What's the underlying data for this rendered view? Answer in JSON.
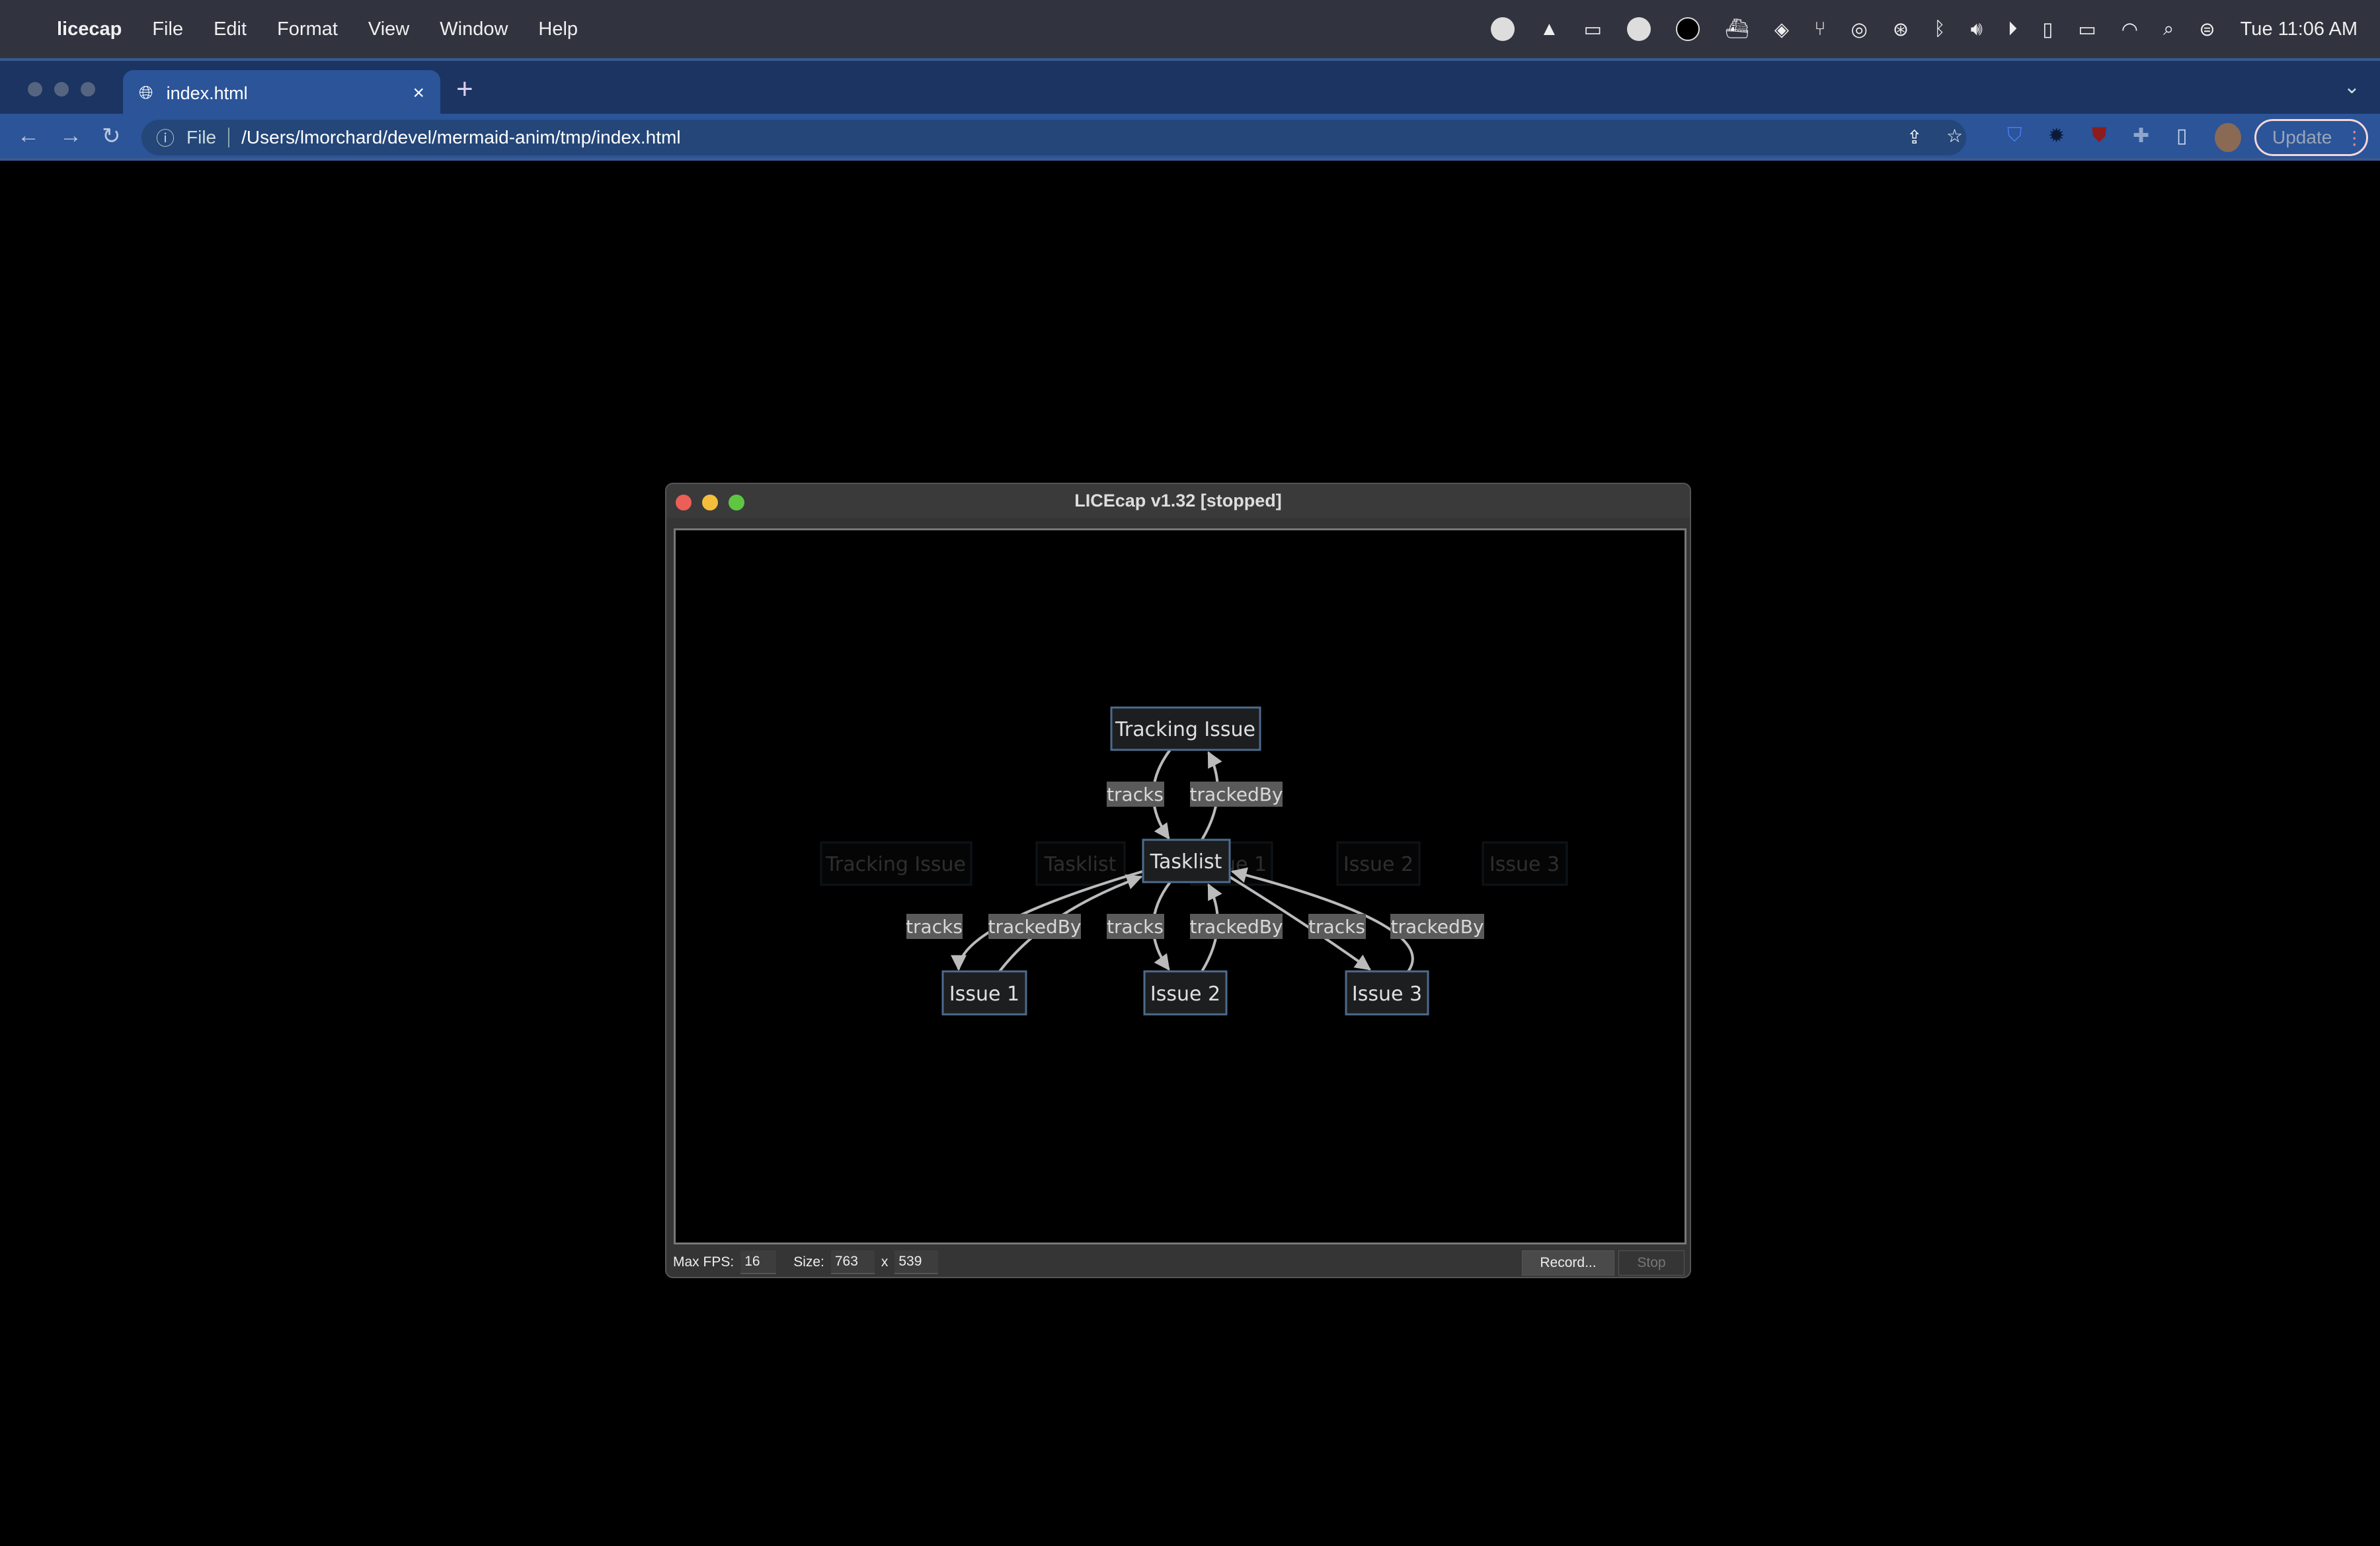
{
  "menubar": {
    "app": "licecap",
    "items": [
      "File",
      "Edit",
      "Format",
      "View",
      "Window",
      "Help"
    ],
    "clock": "Tue 11:06 AM"
  },
  "browser": {
    "tab_title": "index.html",
    "new_tab": "+",
    "close": "×",
    "address_scheme": "File",
    "address": "/Users/lmorchard/devel/mermaid-anim/tmp/index.html",
    "update_label": "Update"
  },
  "licecap": {
    "title": "LICEcap v1.32 [stopped]",
    "max_fps_label": "Max FPS:",
    "max_fps": "16",
    "size_label": "Size:",
    "width": "763",
    "x_label": "x",
    "height": "539",
    "record_label": "Record...",
    "stop_label": "Stop"
  },
  "diagram": {
    "nodes": {
      "tracking": "Tracking Issue",
      "tasklist": "Tasklist",
      "issue1": "Issue 1",
      "issue2": "Issue 2",
      "issue3": "Issue 3"
    },
    "ghost_nodes": [
      "Tracking Issue",
      "Tasklist",
      "Issue 1",
      "Issue 2",
      "Issue 3"
    ],
    "edge_labels": {
      "tracks": "tracks",
      "trackedBy": "trackedBy"
    },
    "colors": {
      "node_fill": "#1c1e20",
      "node_border": "#4d6b8c",
      "edge": "#bbbbbb",
      "label_bg": "#5a5a5a"
    }
  }
}
